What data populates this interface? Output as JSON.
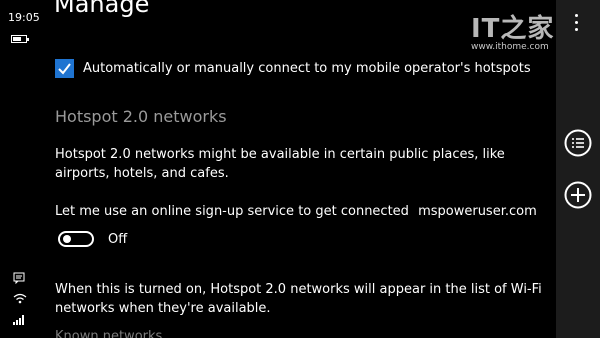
{
  "status_bar": {
    "time": "19:05"
  },
  "page_title": "Manage",
  "auto_connect": {
    "checked": true,
    "label": "Automatically or manually connect to my mobile operator's hotspots"
  },
  "hotspot_section": {
    "title": "Hotspot 2.0 networks",
    "description": "Hotspot 2.0 networks might be available in certain public places, like airports, hotels, and cafes.",
    "signup_label": "Let me use an online sign-up service to get connected",
    "toggle_state": "Off",
    "note": "When this is turned on, Hotspot 2.0 networks will appear in the list of Wi-Fi networks when they're available."
  },
  "cut_off_text": "Known networks",
  "watermarks": {
    "site_logo": "IT之家",
    "site_url": "www.ithome.com",
    "credit": "mspoweruser.com"
  },
  "app_bar": {
    "more_icon": "more-icon",
    "list_icon": "list-icon",
    "add_icon": "add-icon"
  },
  "colors": {
    "accent": "#1f74d1",
    "background": "#000000",
    "app_bar": "#1c1c1c",
    "secondary_text": "#9a9a9a"
  }
}
